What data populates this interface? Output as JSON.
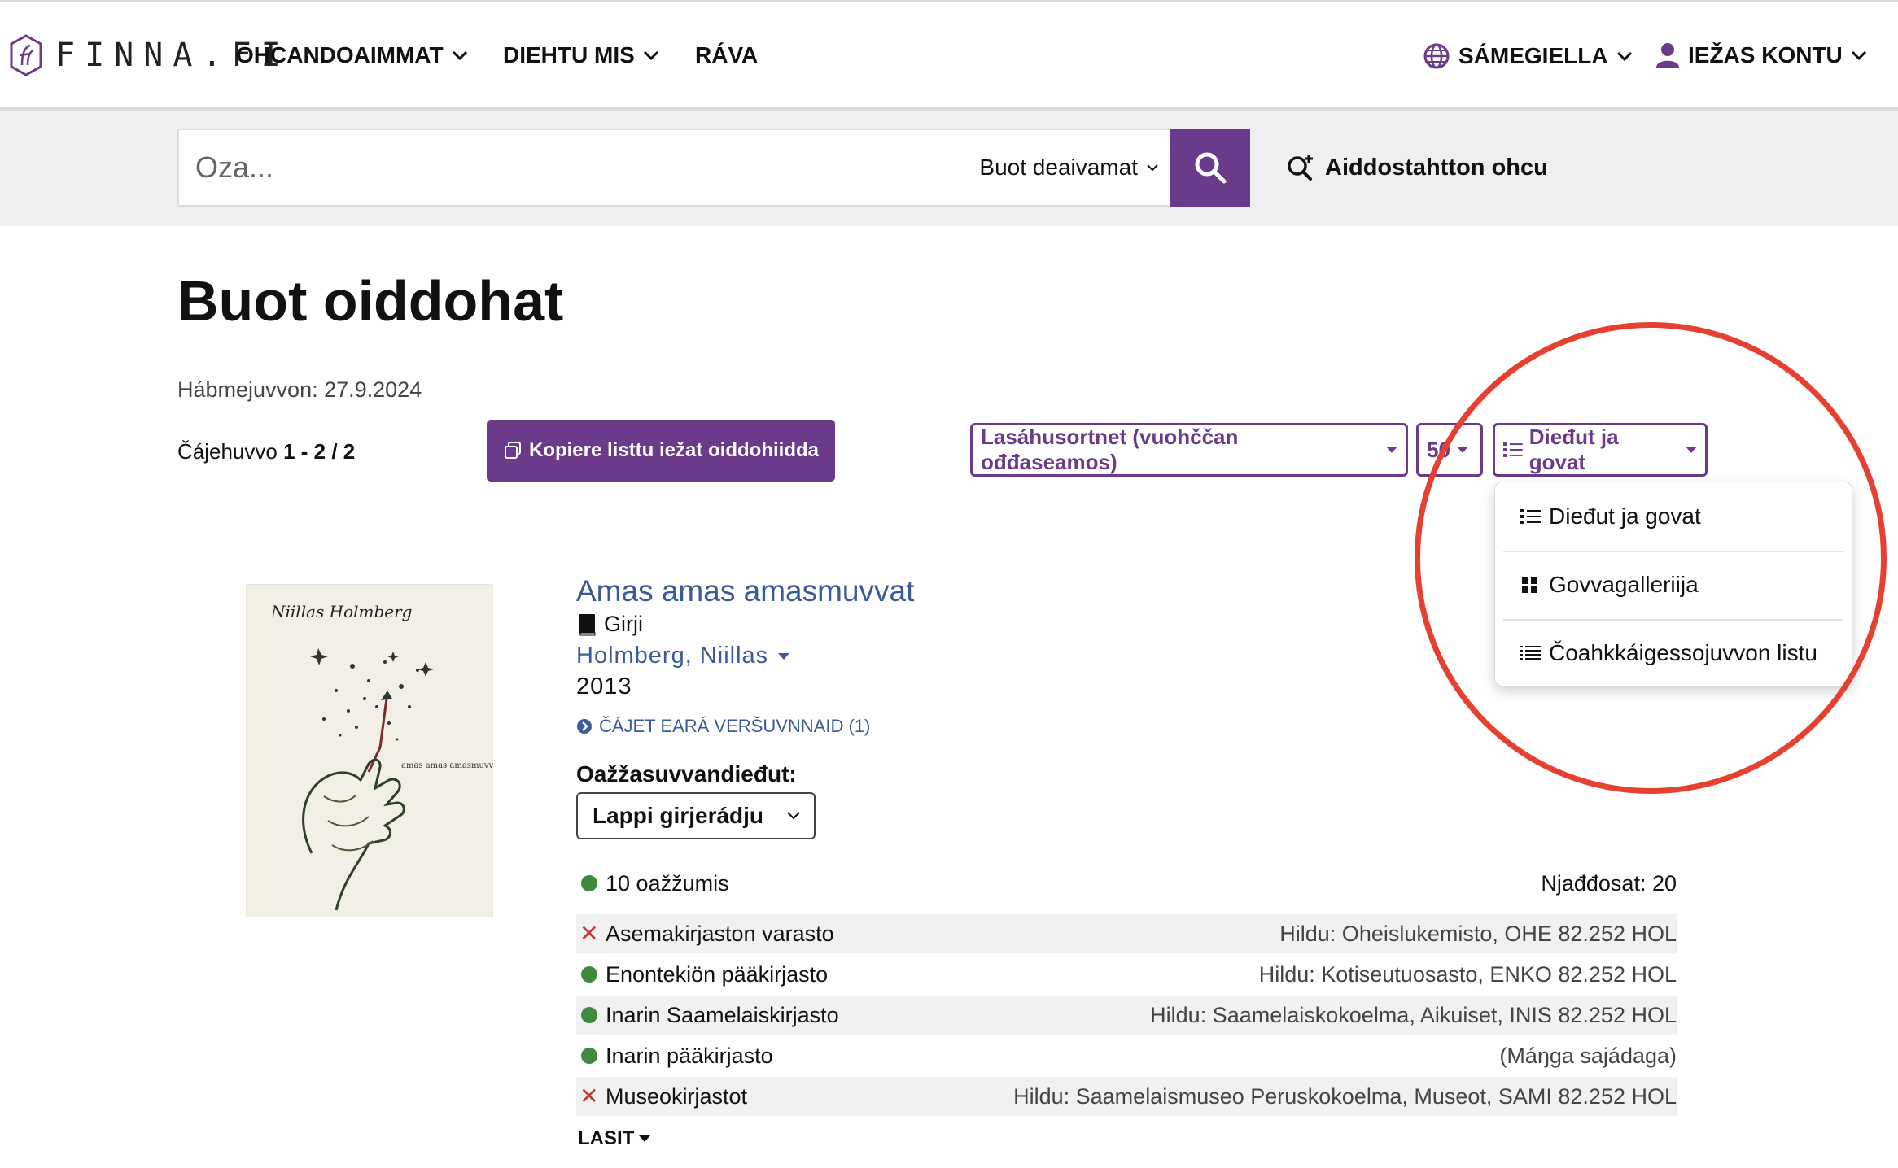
{
  "header": {
    "logo_text": "FINNA.FI",
    "nav": [
      {
        "label": "OHCANDOAIMMAT",
        "icon": "chevron-down-icon"
      },
      {
        "label": "DIEHTU MIS",
        "icon": "chevron-down-icon"
      },
      {
        "label": "RÁVA"
      }
    ],
    "language": "SÁMEGIELLA",
    "account": "IEŽAS KONTU"
  },
  "search": {
    "placeholder": "Oza...",
    "scope": "Buot deaivamat",
    "advanced": "Aiddostahtton ohcu"
  },
  "page": {
    "title": "Buot oiddohat",
    "updated": "Hábmejuvvon: 27.9.2024",
    "results_prefix": "Čájehuvvo ",
    "results_range": "1 - 2",
    "results_sep": " / ",
    "results_total": "2",
    "copy_button": "Kopiere listtu iežat oiddohiidda"
  },
  "controls": {
    "sort": "Lasáhusortnet (vuohččan ođđaseamos)",
    "per_page": "50",
    "view": "Dieđut ja govat"
  },
  "view_menu": [
    {
      "label": "Dieđut ja govat",
      "icon": "list-detail-icon"
    },
    {
      "label": "Govvagalleriija",
      "icon": "grid-icon"
    },
    {
      "label": "Čoahkkáigessojuvvon listu",
      "icon": "compact-list-icon"
    }
  ],
  "record": {
    "title": "Amas amas amasmuvvat",
    "format": "Girji",
    "author": "Holmberg, Niillas",
    "year": "2013",
    "versions": "ČÁJET EARÁ VERŠUVNNAID (1)",
    "cover_caption": "Niillas Holmberg",
    "cover_small_text": "amas amas amasmuvvat",
    "availability_label": "Oažžasuvvandieđut:",
    "organisation": "Lappi girjerádju",
    "summary_available": "10 oažžumis",
    "summary_reservations": "Njađđosat: 20",
    "holdings": [
      {
        "status": "unavailable",
        "name": "Asemakirjaston varasto",
        "location": "Hildu: Oheislukemisto, OHE 82.252 HOL"
      },
      {
        "status": "available",
        "name": "Enontekiön pääkirjasto",
        "location": "Hildu: Kotiseutuosasto, ENKO 82.252 HOL"
      },
      {
        "status": "available",
        "name": "Inarin Saamelaiskirjasto",
        "location": "Hildu: Saamelaiskokoelma, Aikuiset, INIS 82.252 HOL"
      },
      {
        "status": "available",
        "name": "Inarin pääkirjasto",
        "location": "(Máŋga sajádaga)"
      },
      {
        "status": "unavailable",
        "name": "Museokirjastot",
        "location": "Hildu: Saamelaismuseo Peruskokoelma, Museot, SAMI 82.252 HOL"
      }
    ],
    "more_label": "LASIT"
  },
  "colors": {
    "brand": "#6b3a8a",
    "link": "#3a5a9a",
    "available": "#3f8a3c",
    "unavailable": "#c0392b",
    "annotation": "#e64030"
  }
}
